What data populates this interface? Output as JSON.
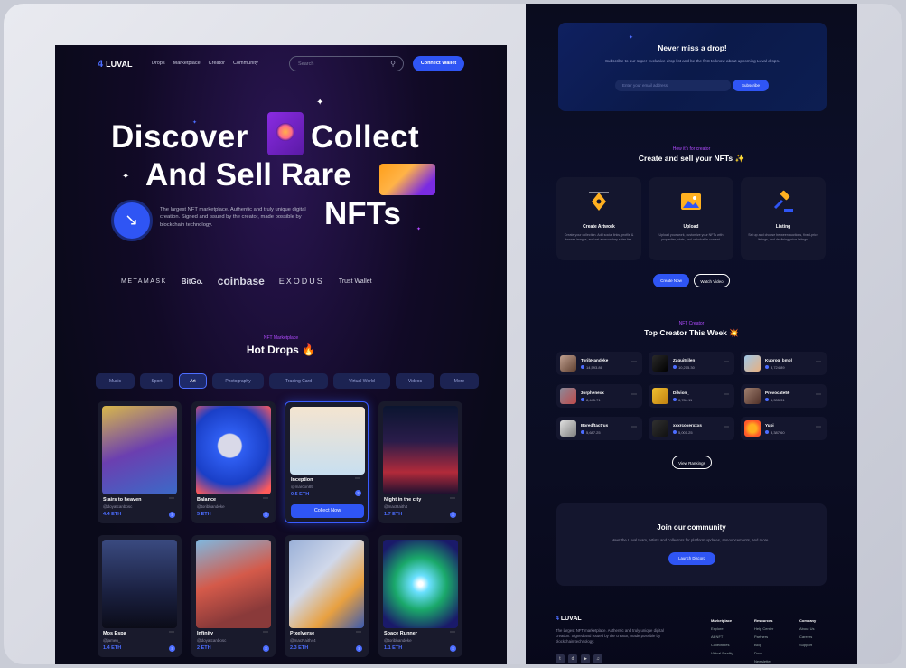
{
  "nav": {
    "logo": "LUVAL",
    "links": [
      "Drops",
      "Marketplace",
      "Creator",
      "Community"
    ],
    "search_placeholder": "Search",
    "connect": "Connect Wallet"
  },
  "hero": {
    "line1a": "Discover",
    "line1b": "Collect",
    "line2": "And Sell Rare",
    "line3": "NFTs",
    "desc": "The largest NFT marketplace. Authentic and truly unique digital creation. Signed and issued by the creator, made possible by blockchain technology."
  },
  "brands": [
    "METAMASK",
    "BitGo.",
    "coinbase",
    "EXODUS",
    "Trust Wallet"
  ],
  "hotdrops": {
    "eyebrow": "NFT Marketplace",
    "title": "Hot Drops 🔥",
    "tabs": [
      "Music",
      "Sport",
      "Art",
      "Photography",
      "Trading Card",
      "Virtual World",
      "Videos",
      "More"
    ],
    "active_tab": "Art",
    "collect_label": "Collect Now",
    "cards": [
      {
        "name": "Stairs to heaven",
        "author": "@doyatcanbosc",
        "price": "4.4 ETH"
      },
      {
        "name": "Balance",
        "author": "@toribhandeke",
        "price": "5 ETH"
      },
      {
        "name": "Inception",
        "author": "@marcon89",
        "price": "0.5 ETH"
      },
      {
        "name": "Night in the city",
        "author": "@macRaith4",
        "price": "1.7 ETH"
      },
      {
        "name": "Mos Espa",
        "author": "@jamen_",
        "price": "1.4 ETH"
      },
      {
        "name": "Infinity",
        "author": "@doyatcanbosc",
        "price": "2 ETH"
      },
      {
        "name": "Pixelverse",
        "author": "@macRaith44",
        "price": "2.3 ETH"
      },
      {
        "name": "Space Runner",
        "author": "@toribhandeke",
        "price": "1.1 ETH"
      }
    ]
  },
  "newsletter": {
    "title": "Never miss a drop!",
    "sub": "Subscribe to our super-exclusive drop list and be the first to know about upcoming Luval drops.",
    "placeholder": "Enter your email address",
    "button": "Subscribe"
  },
  "create": {
    "eyebrow": "How it's for creator",
    "title": "Create and sell your NFTs ✨",
    "steps": [
      {
        "title": "Create Artwork",
        "desc": "Create your collection. Add social links, profile & banner images, and set a secondary sales fee."
      },
      {
        "title": "Upload",
        "desc": "Upload your work, customize your NFTs with properties, stats, and unlockable content."
      },
      {
        "title": "Listing",
        "desc": "Set up and choose between auctions, fixed-price listings, and declining-price listings."
      }
    ],
    "btn_create": "Create Now",
    "btn_watch": "Watch Video"
  },
  "creators": {
    "eyebrow": "NFT Creator",
    "title": "Top Creator This Week 💥",
    "list": [
      {
        "name": "ToribHandeke",
        "value": "14,593.86"
      },
      {
        "name": "Zaqui5tilen_",
        "value": "10,215.30"
      },
      {
        "name": "Kuprog_bmbl",
        "value": "8,724.89"
      },
      {
        "name": "3orphenexx",
        "value": "8,445.71"
      },
      {
        "name": "Dilvion_",
        "value": "6,784.11"
      },
      {
        "name": "Provocate59",
        "value": "6,335.31"
      },
      {
        "name": "Boredftactrus",
        "value": "5,687.25"
      },
      {
        "name": "xxxrcoxerxxxs",
        "value": "5,001.25"
      },
      {
        "name": "Yupi",
        "value": "3,387.60"
      }
    ],
    "button": "View Rankings"
  },
  "community": {
    "title": "Join our community",
    "sub": "Meet the Luval team, artists and collectors for platform updates, announcements, and more...",
    "button": "Launch Discord"
  },
  "footer": {
    "logo": "LUVAL",
    "desc": "The largest NFT marketplace. Authentic and truly unique digital creation. Signed and issued by the creator, made possible by blockchain technology.",
    "cols": [
      {
        "head": "Marketplace",
        "items": [
          "Explore",
          "All NFT",
          "Collectibles",
          "Virtual Reality"
        ]
      },
      {
        "head": "Resources",
        "items": [
          "Help Center",
          "Partners",
          "Blog",
          "Docs",
          "Newsletter"
        ]
      },
      {
        "head": "Company",
        "items": [
          "About Us",
          "Careers",
          "Support"
        ]
      }
    ]
  }
}
